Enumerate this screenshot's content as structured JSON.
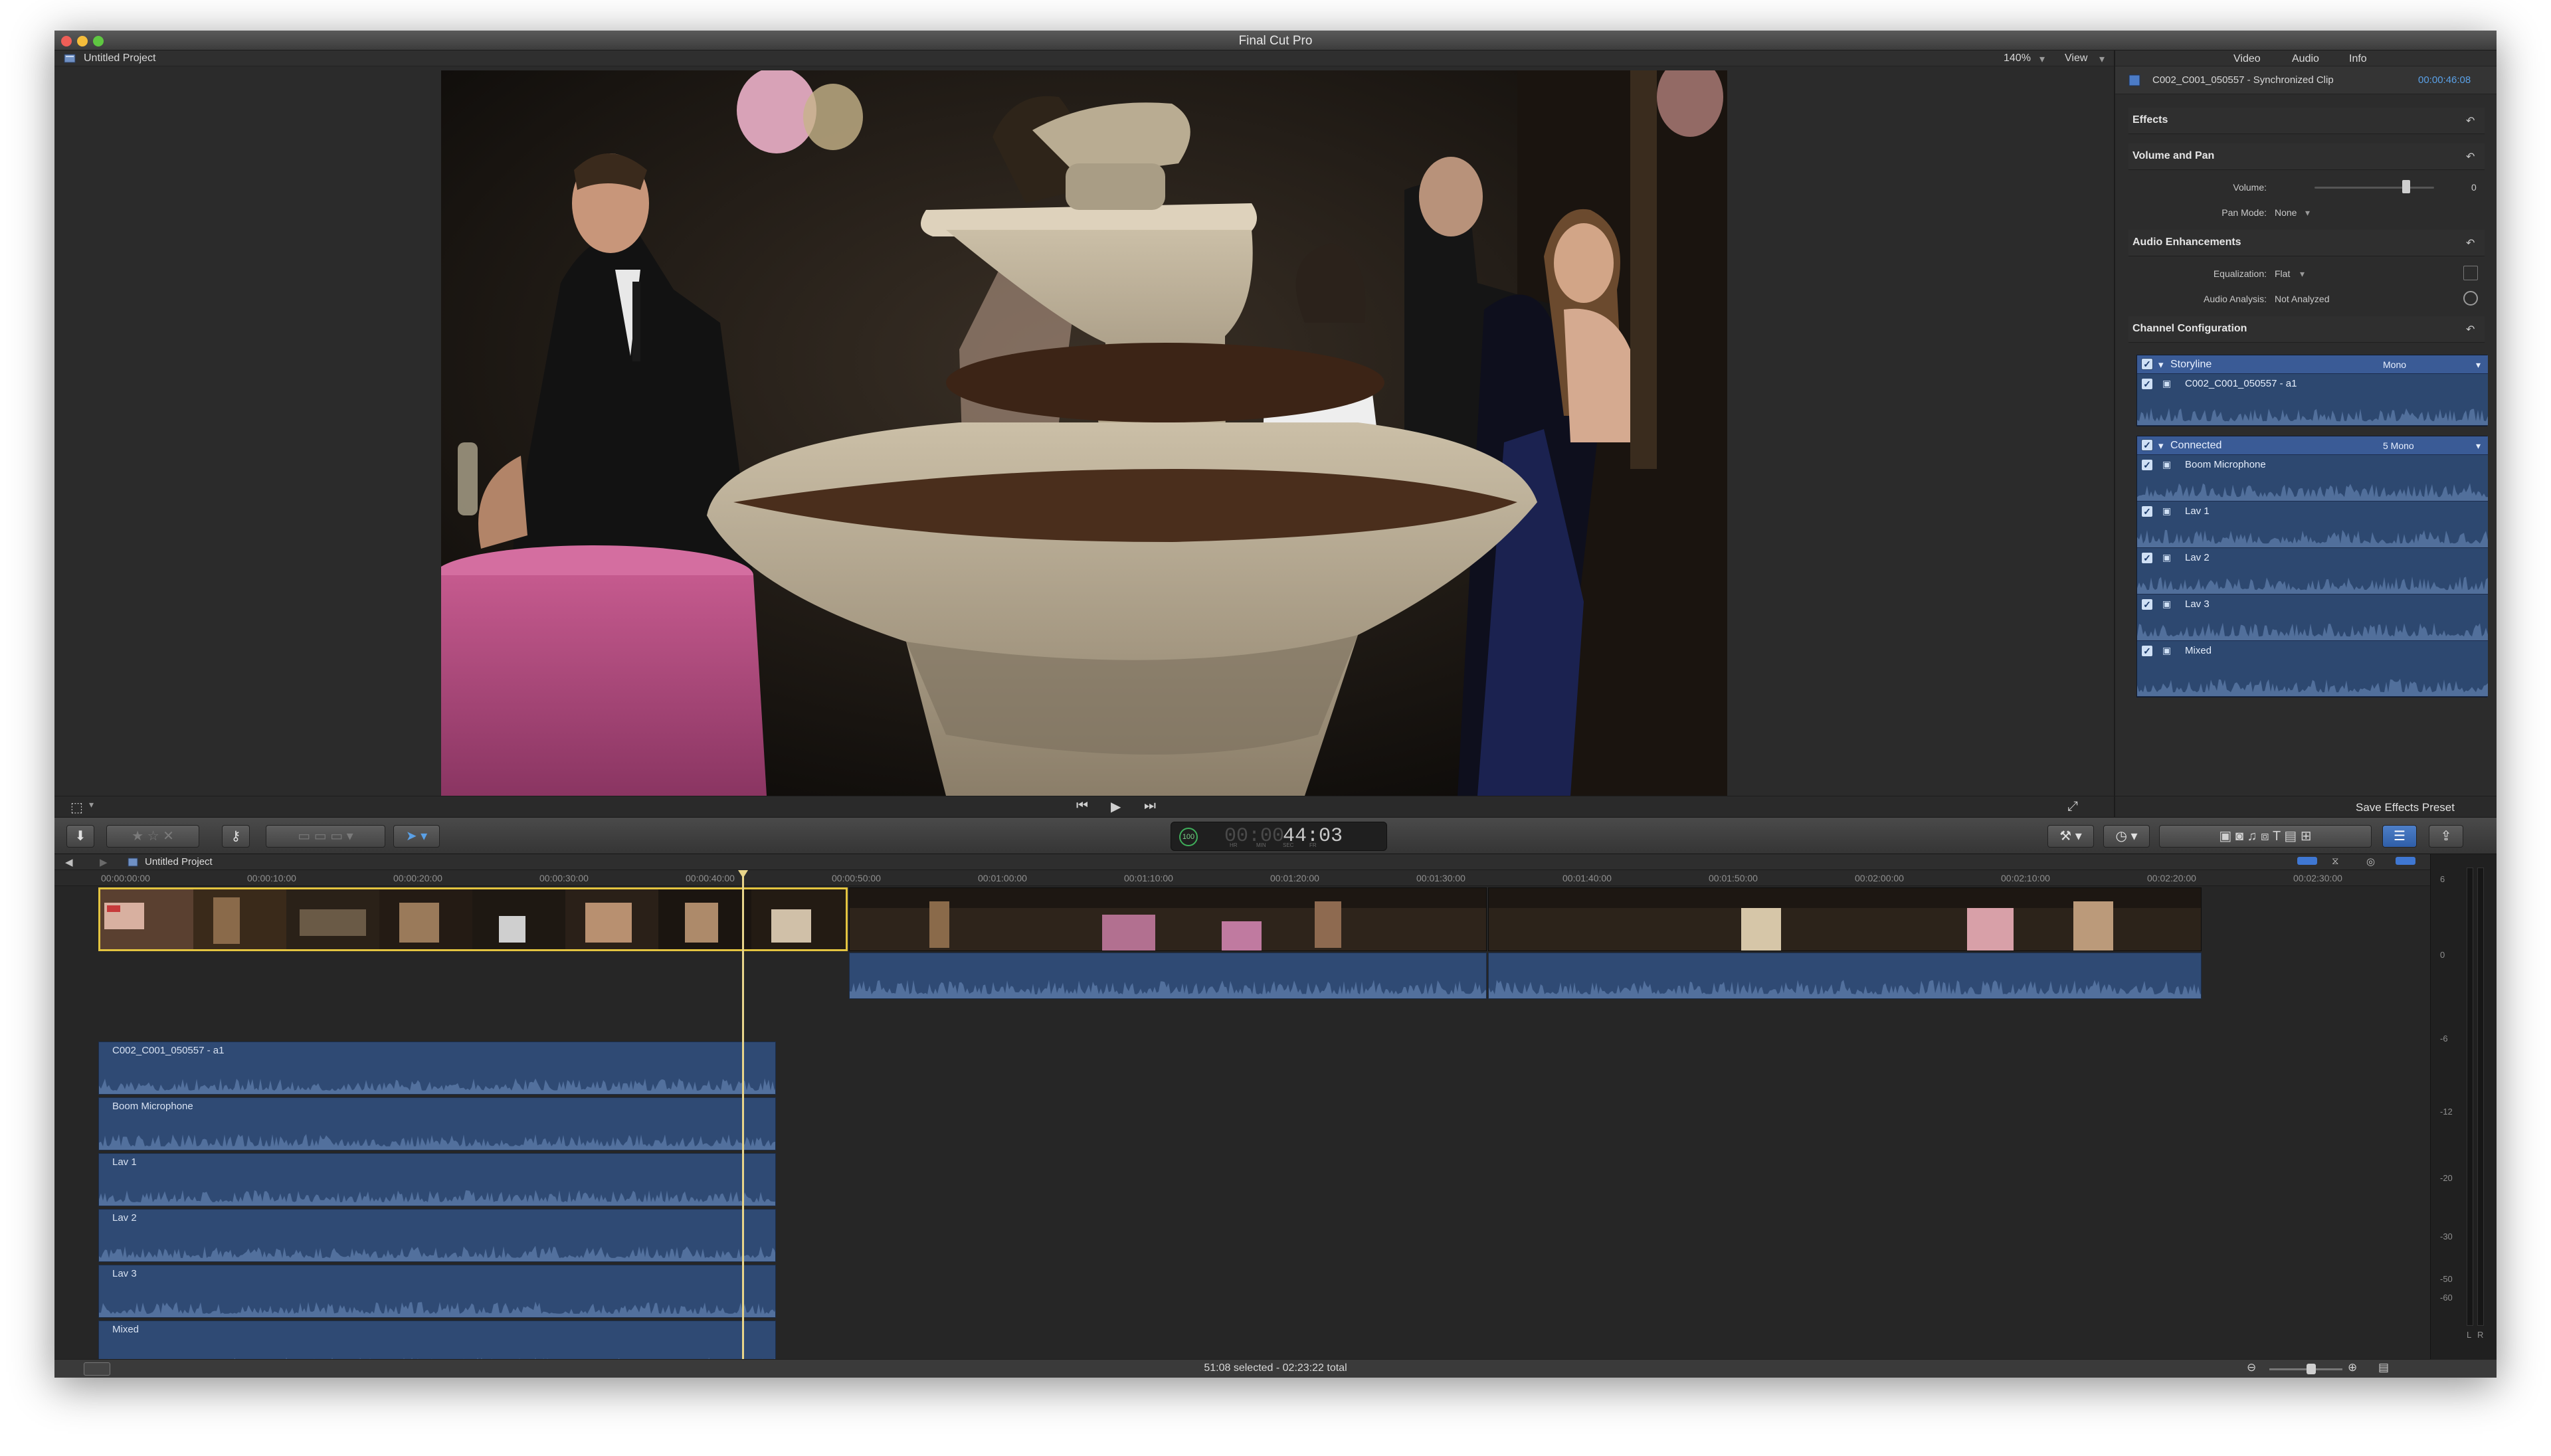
{
  "window": {
    "title": "Final Cut Pro",
    "traffic_lights": [
      "#ee5e57",
      "#f5bd3b",
      "#5fc741"
    ]
  },
  "viewer": {
    "project_name": "Untitled Project",
    "zoom": "140%",
    "view_label": "View"
  },
  "inspector": {
    "tabs": [
      "Video",
      "Audio",
      "Info"
    ],
    "clip_name": "C002_C001_050557 - Synchronized Clip",
    "clip_duration": "00:00:46:08",
    "sections": {
      "effects": "Effects",
      "volume_pan": "Volume and Pan",
      "audio_enhancements": "Audio Enhancements",
      "channel_config": "Channel Configuration"
    },
    "volume_label": "Volume:",
    "volume_value": "0",
    "pan_mode_label": "Pan Mode:",
    "pan_mode_value": "None",
    "equalization_label": "Equalization:",
    "equalization_value": "Flat",
    "analysis_label": "Audio Analysis:",
    "analysis_value": "Not Analyzed",
    "storyline_label": "Storyline",
    "storyline_mode": "Mono",
    "storyline_channels": [
      "C002_C001_050557 - a1"
    ],
    "connected_label": "Connected",
    "connected_mode": "5 Mono",
    "connected_channels": [
      "Boom Microphone",
      "Lav 1",
      "Lav 2",
      "Lav 3",
      "Mixed"
    ],
    "save_preset": "Save Effects Preset"
  },
  "toolbar": {
    "timecode": "44:03",
    "timecode_dim": "00:00",
    "timecode_units": [
      "HR",
      "MIN",
      "SEC",
      "FR"
    ],
    "percent": "100"
  },
  "timeline": {
    "project_name": "Untitled Project",
    "ruler_ticks": [
      "00:00:00:00",
      "00:00:10:00",
      "00:00:20:00",
      "00:00:30:00",
      "00:00:40:00",
      "00:00:50:00",
      "00:01:00:00",
      "00:01:10:00",
      "00:01:20:00",
      "00:01:30:00",
      "00:01:40:00",
      "00:01:50:00",
      "00:02:00:00",
      "00:02:10:00",
      "00:02:20:00",
      "00:02:30:00"
    ],
    "audio_lanes": [
      "C002_C001_050557 - a1",
      "Boom Microphone",
      "Lav 1",
      "Lav 2",
      "Lav 3",
      "Mixed"
    ],
    "meter_labels": [
      "6",
      "0",
      "-6",
      "-12",
      "-20",
      "-30",
      "-50",
      "-60"
    ],
    "meter_channels": [
      "L",
      "R"
    ]
  },
  "status": {
    "summary": "51:08 selected - 02:23:22 total"
  },
  "colors": {
    "audio_blue": "#2f4a74",
    "channel_header": "#3a5b96",
    "selection_yellow": "#e3c440",
    "playhead": "#e8d58a",
    "accent": "#5aa0e6"
  }
}
